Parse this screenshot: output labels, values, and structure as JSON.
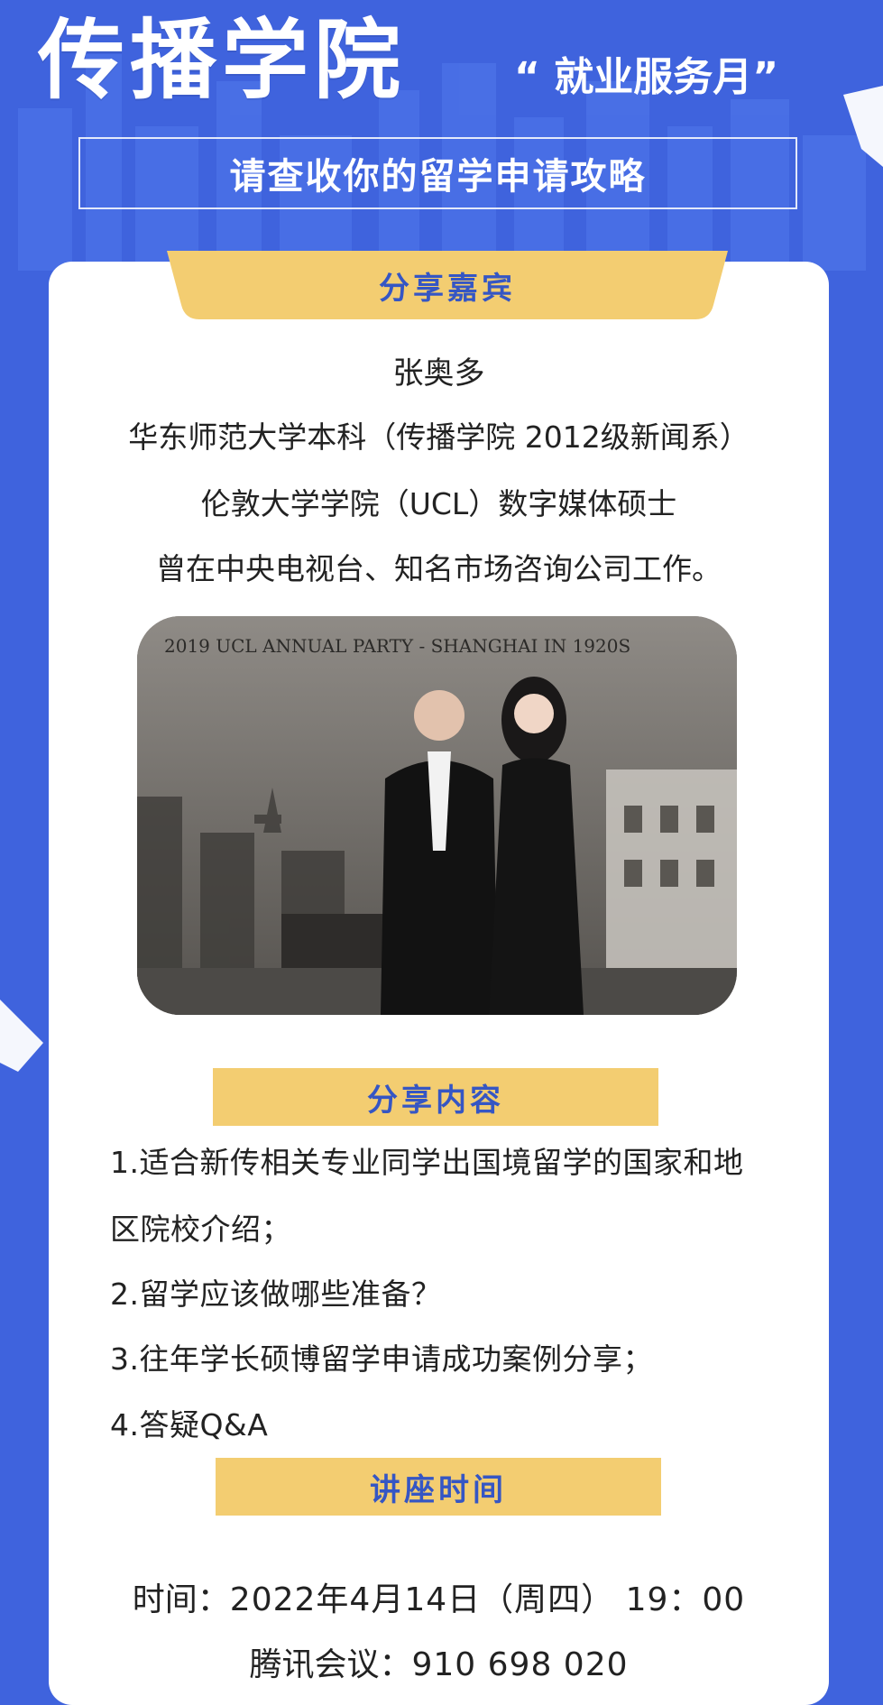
{
  "header": {
    "title": "传播学院",
    "tag": "“ 就业服务月”",
    "subtitle": "请查收你的留学申请攻略"
  },
  "guest_section": {
    "label": "分享嘉宾",
    "name": "张奥多",
    "lines": [
      "华东师范大学本科（传播学院  2012级新闻系）",
      "伦敦大学学院（UCL）数字媒体硕士",
      "曾在中央电视台、知名市场咨询公司工作。"
    ],
    "photo_caption": "2019 UCL ANNUAL PARTY - SHANGHAI IN 1920S"
  },
  "content_section": {
    "label": "分享内容",
    "items": [
      "1.适合新传相关专业同学出国境留学的国家和地",
      "区院校介绍；",
      "2.留学应该做哪些准备？",
      "3.往年学长硕博留学申请成功案例分享；",
      "4.答疑Q&A"
    ]
  },
  "time_section": {
    "label": "讲座时间",
    "time_prefix": "时间：",
    "time_value": "2022年4月14日（周四）  19：00",
    "meeting_prefix": "腾讯会议：",
    "meeting_value": "910 698 020"
  },
  "colors": {
    "background": "#3f63dd",
    "accent": "#f3cd71",
    "label_text": "#3556c4"
  }
}
